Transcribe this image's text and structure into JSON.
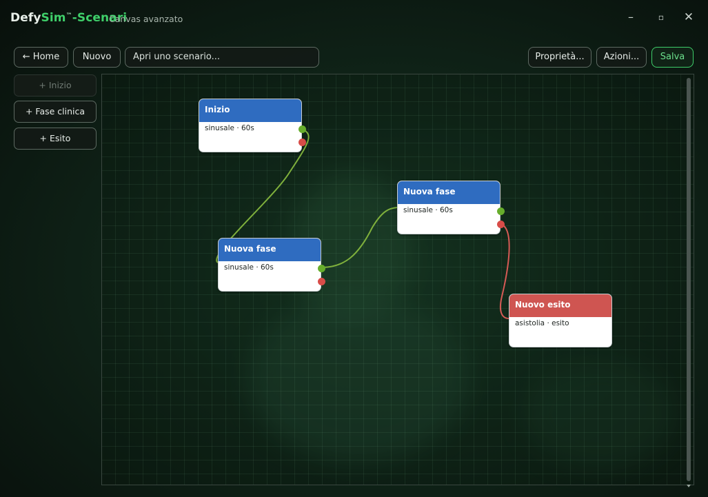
{
  "app": {
    "brand_part1": "Defy",
    "brand_part2": "Sim",
    "brand_tm": "™",
    "brand_part3": "-Scenari",
    "subtitle": "Canvas avanzato"
  },
  "window_controls": {
    "minimize": "–",
    "maximize": "▫",
    "close": "✕"
  },
  "toolbar": {
    "home_label": "← Home",
    "new_label": "Nuovo",
    "open_placeholder": "Apri uno scenario...",
    "properties_label": "Proprietà...",
    "actions_label": "Azioni...",
    "save_label": "Salva"
  },
  "sidebar": {
    "items": [
      {
        "label": "+ Inizio",
        "disabled": true
      },
      {
        "label": "+ Fase clinica",
        "disabled": false
      },
      {
        "label": "+ Esito",
        "disabled": false
      }
    ]
  },
  "nodes": [
    {
      "title": "Inizio",
      "detail": "sinusale · 60s",
      "kind": "start"
    },
    {
      "title": "Nuova fase",
      "detail": "sinusale · 60s",
      "kind": "phase"
    },
    {
      "title": "Nuova fase",
      "detail": "sinusale · 60s",
      "kind": "phase"
    },
    {
      "title": "Nuovo esito",
      "detail": "asistolia · esito",
      "kind": "outcome"
    }
  ],
  "colors": {
    "accent_green": "#3fcf6a",
    "node_header_blue": "#2f6cc0",
    "node_header_red": "#cf5551",
    "link_success": "#7fb03c",
    "link_failure": "#d65a55"
  }
}
